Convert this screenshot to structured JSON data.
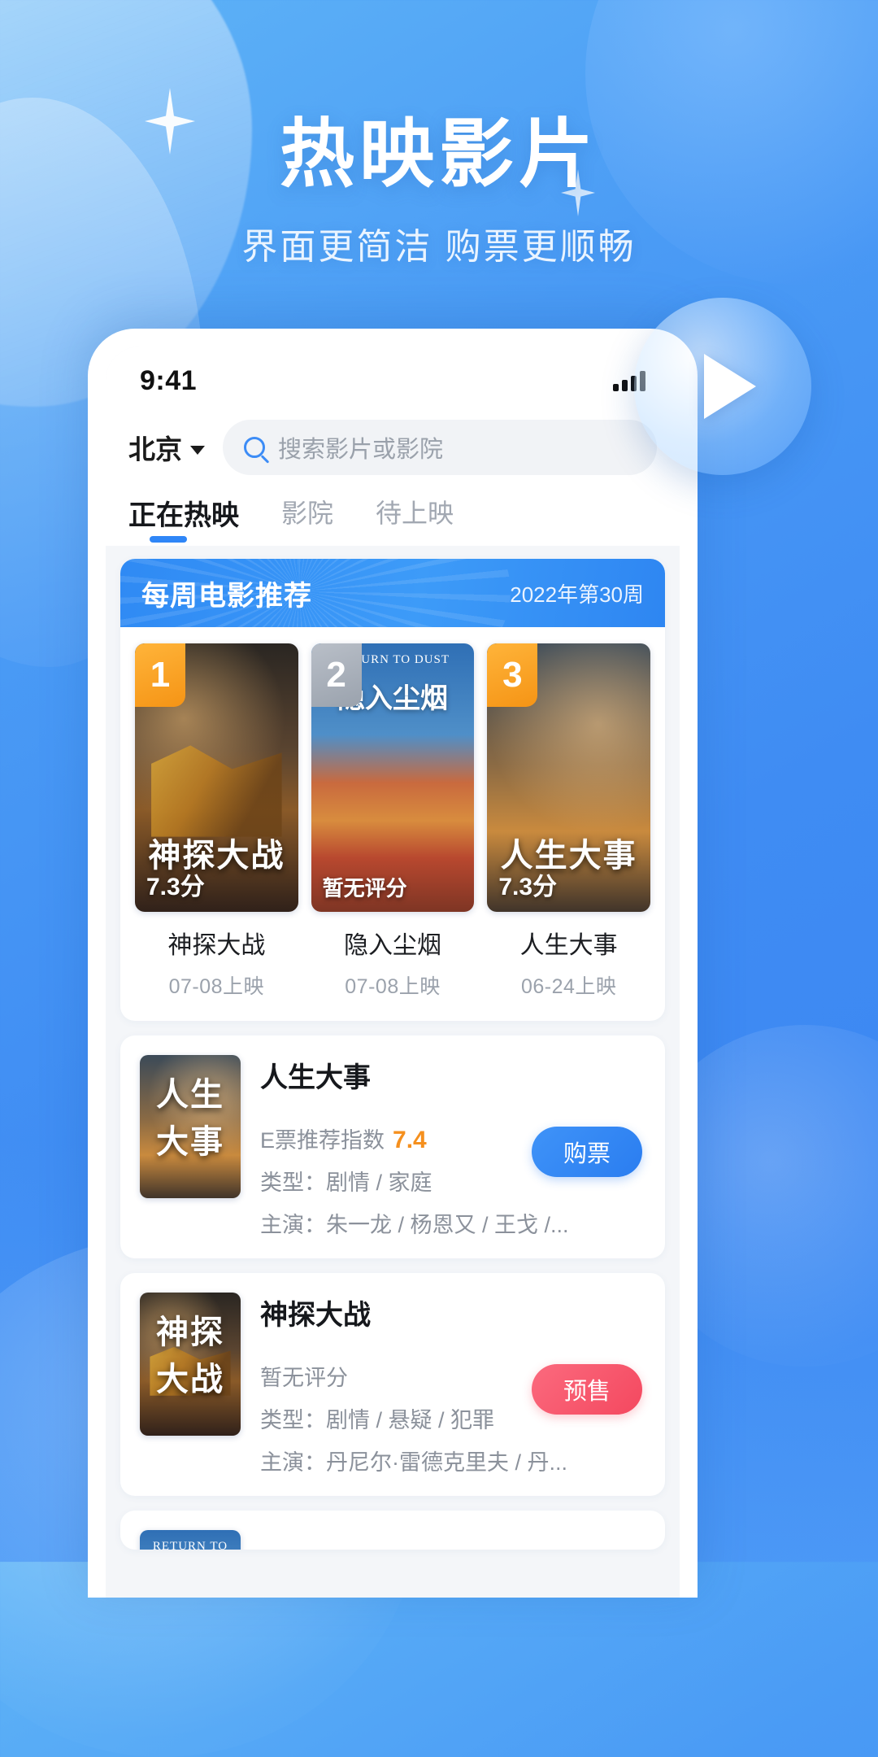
{
  "hero": {
    "title": "热映影片",
    "subtitle": "界面更简洁 购票更顺畅"
  },
  "phone": {
    "status": {
      "time": "9:41",
      "signal_icon": "signal-bars-icon"
    },
    "city": {
      "name": "北京",
      "caret_icon": "chevron-down-icon"
    },
    "search": {
      "placeholder": "搜索影片或影院",
      "icon": "search-icon"
    },
    "tabs": [
      {
        "label": "正在热映",
        "active": true
      },
      {
        "label": "影院",
        "active": false
      },
      {
        "label": "待上映",
        "active": false
      }
    ],
    "weekly": {
      "title": "每周电影推荐",
      "week": "2022年第30周",
      "items": [
        {
          "rank": "1",
          "rank_style": "gold",
          "score": "7.3分",
          "name": "神探大战",
          "date": "07-08上映"
        },
        {
          "rank": "2",
          "rank_style": "silver",
          "score": "暂无评分",
          "name": "隐入尘烟",
          "date": "07-08上映"
        },
        {
          "rank": "3",
          "rank_style": "gold",
          "score": "7.3分",
          "name": "人生大事",
          "date": "06-24上映"
        }
      ]
    },
    "movies": [
      {
        "title": "人生大事",
        "rating_label": "E票推荐指数",
        "rating_value": "7.4",
        "genre": "类型：剧情 / 家庭",
        "cast": "主演：朱一龙 / 杨恩又 / 王戈 /...",
        "button": "购票",
        "button_style": "buy"
      },
      {
        "title": "神探大战",
        "rating_label": "暂无评分",
        "rating_value": "",
        "genre": "类型：剧情 / 悬疑 / 犯罪",
        "cast": "主演：丹尼尔·雷德克里夫 / 丹...",
        "button": "预售",
        "button_style": "pre"
      }
    ]
  },
  "colors": {
    "brand_blue": "#2f86f7",
    "accent_orange": "#f5901e",
    "presale_pink": "#f4485f",
    "bg_gradient_start": "#5fb4f7",
    "bg_gradient_end": "#3a84f2"
  }
}
